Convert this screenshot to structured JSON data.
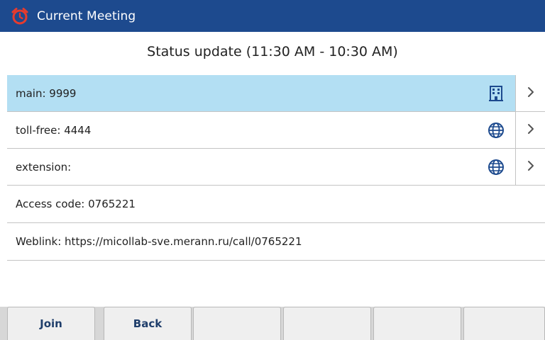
{
  "header": {
    "title": "Current Meeting",
    "icon": "alarm-clock-icon",
    "icon_color": "#e63b2e",
    "background": "#1d4a8e"
  },
  "meeting": {
    "subject": "Status update (11:30 AM - 10:30 AM)"
  },
  "dial_items": [
    {
      "label": "main: 9999",
      "icon": "building-icon",
      "selected": true
    },
    {
      "label": "toll-free: 4444",
      "icon": "globe-icon",
      "selected": false
    },
    {
      "label": "extension:",
      "icon": "globe-icon",
      "selected": false
    }
  ],
  "info_items": [
    {
      "label": "Access code: 0765221"
    },
    {
      "label": "Weblink: https://micollab-sve.merann.ru/call/0765221"
    }
  ],
  "softkeys": {
    "join": "Join",
    "back": "Back",
    "key3": "",
    "key4": "",
    "key5": "",
    "key6": ""
  },
  "colors": {
    "selected_row": "#b3dff3",
    "icon_blue": "#1d4a8e",
    "softkey_text": "#1f3e6b"
  }
}
